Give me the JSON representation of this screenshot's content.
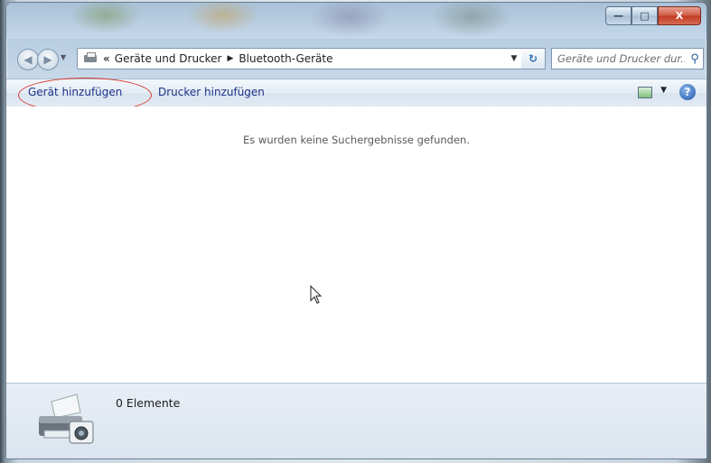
{
  "window": {
    "controls": {
      "minimize": "—",
      "maximize": "□",
      "close": "X"
    }
  },
  "nav": {
    "back_icon": "back-arrow-icon",
    "forward_icon": "forward-arrow-icon",
    "address_prefix": "«",
    "breadcrumb": [
      "Geräte und Drucker",
      "Bluetooth-Geräte"
    ],
    "search_placeholder": "Geräte und Drucker dur..."
  },
  "commandbar": {
    "add_device": "Gerät hinzufügen",
    "add_printer": "Drucker hinzufügen",
    "highlight_color": "#d7372f"
  },
  "content": {
    "empty_message": "Es wurden keine Suchergebnisse gefunden."
  },
  "details": {
    "count_text": "0 Elemente"
  }
}
